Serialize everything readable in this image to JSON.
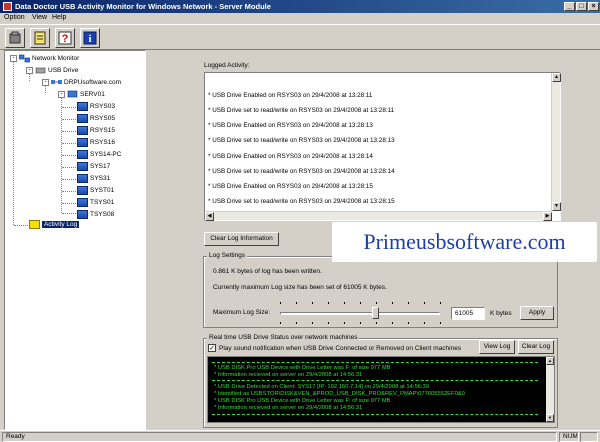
{
  "window": {
    "title": "Data Doctor USB Activity Monitor for Windows Network - Server Module",
    "controls": {
      "minimize": "_",
      "maximize": "□",
      "close": "×"
    }
  },
  "menu": [
    {
      "label": "Option"
    },
    {
      "label": "View"
    },
    {
      "label": "Help"
    }
  ],
  "toolbar": {
    "buttons": [
      {
        "icon": "usb-disk-icon"
      },
      {
        "icon": "notepad-icon"
      },
      {
        "icon": "help-icon"
      },
      {
        "icon": "info-icon"
      }
    ]
  },
  "tree": {
    "root": "Network Monitor",
    "usb_drive": "USB Drive",
    "domain": "DRPUsoftware.com",
    "server": "SERV01",
    "clients": [
      "RSYS03",
      "RSYS05",
      "RSYS15",
      "RSYS16",
      "SYS14-PC",
      "SYS17",
      "SYS31",
      "SYST01",
      "TSYS01",
      "TSYS08"
    ],
    "activity_log": "Activity Log"
  },
  "logged_activity": {
    "label": "Logged Activity:",
    "lines": [
      "* USB Drive Enabled on RSYS03 on 29/4/2008 at 13:28:11",
      "* USB Drive set to read/write on RSYS03 on 29/4/2008 at 13:28:11",
      "* USB Drive Enabled on RSYS03 on 29/4/2008 at 13:28:13",
      "* USB Drive set to read/write on RSYS03 on 29/4/2008 at 13:28:13",
      "* USB Drive Enabled on RSYS03 on 29/4/2008 at 13:28:14",
      "* USB Drive set to read/write on RSYS03 on 29/4/2008 at 13:28:14",
      "* USB Drive Enabled on RSYS03 on 29/4/2008 at 13:28:15",
      "* USB Drive set to read/write on RSYS03 on 29/4/2008 at 13:28:15"
    ],
    "clear_button": "Clear Log Information"
  },
  "log_settings": {
    "title": "Log Settings",
    "written_text": "0.861 K bytes of log has been written.",
    "max_size_text": "Currently maximum Log size has been set of 61005 K bytes.",
    "max_label": "Maximum Log Size:",
    "slider_fraction": 0.6,
    "value": "61005",
    "unit": "K bytes",
    "apply_button": "Apply"
  },
  "realtime": {
    "title": "Real time USB Drive Status over network machines",
    "checkbox_label": "Play sound notification when USB Drive Connected or Removed on Client machines",
    "checked": true,
    "view_log_button": "View Log",
    "clear_log_button": "Clear Log",
    "console_lines": [
      "* USB DISK Pro USB Device  with Drive Letter was F: of size 977 MB",
      "* Information recieved on server on 29/4/2008 at 14:56:31",
      "* USB Drive Detected on Client: SYS17 [IP: 192.160.7.14] on 29/4/2008 at 14:56:30",
      "* Identified as USBSTOR\\DISK&VEN_&PROD_USB_DISK_PRO&REV_PMAP\\077605552EF0&0",
      "* USB DISK Pro USB Device  with Drive Letter was F: of size 977 MB",
      "* Information recieved on server on 29/4/2008 at 14:56:31"
    ]
  },
  "watermark": "Primeusbsoftware.com",
  "status": {
    "text": "Ready",
    "num": "NUM"
  },
  "colors": {
    "title_bar": "#0a246a",
    "window_bg": "#d4d0c8",
    "console_bg": "#000000",
    "console_text": "#33dd33",
    "watermark_text": "#1e3fa2"
  }
}
